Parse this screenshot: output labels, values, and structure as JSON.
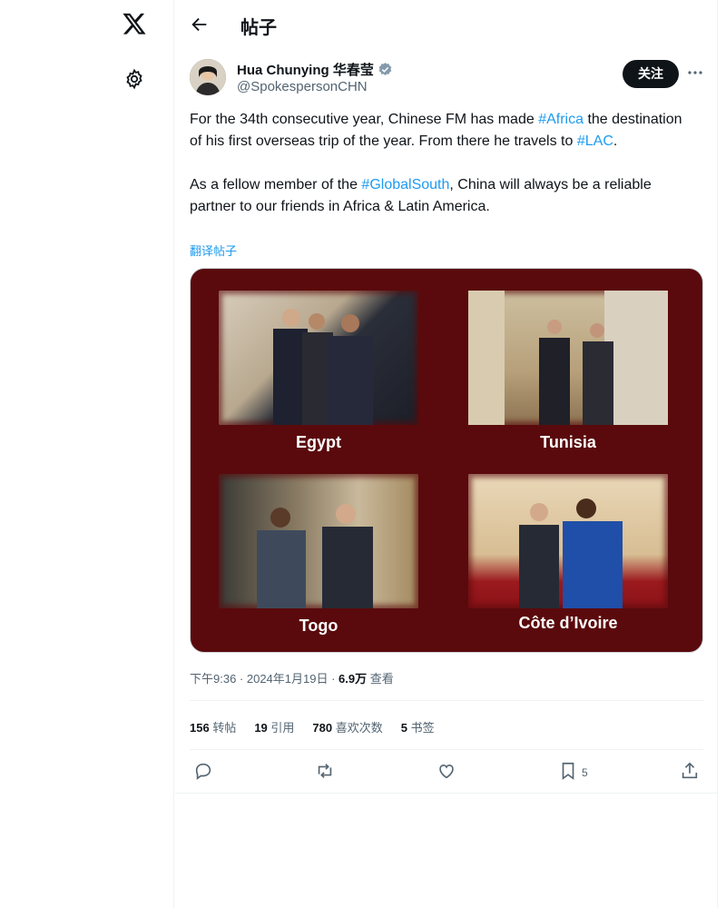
{
  "nav": {
    "logo_icon": "x-logo-icon",
    "settings_icon": "gear-icon"
  },
  "header": {
    "title": "帖子",
    "back_icon": "arrow-left-icon"
  },
  "author": {
    "name": "Hua Chunying 华春莹",
    "handle": "@SpokespersonCHN",
    "verified_icon": "verified-badge-icon",
    "follow_label": "关注"
  },
  "tweet": {
    "p1_a": "For the 34th consecutive year, Chinese FM has made ",
    "p1_tag1": "#Africa",
    "p1_b": " the destination of his first overseas trip of the year. From there he travels to ",
    "p1_tag2": "#LAC",
    "p1_c": ".",
    "p2_a": "As a fellow member of the ",
    "p2_tag": "#GlobalSouth",
    "p2_b": ", China will always be a reliable partner to our friends in Africa & Latin America.",
    "translate": "翻译帖子"
  },
  "media": {
    "background": "#5a0a0c",
    "captions": [
      "Egypt",
      "Tunisia",
      "Togo",
      "Côte d’Ivoire"
    ]
  },
  "meta": {
    "time": "下午9:36 · 2024年1月19日 · ",
    "views": "6.9万",
    "views_label": " 查看"
  },
  "stats": [
    {
      "count": "156",
      "label": " 转帖"
    },
    {
      "count": "19",
      "label": " 引用"
    },
    {
      "count": "780",
      "label": " 喜欢次数"
    },
    {
      "count": "5",
      "label": " 书签"
    }
  ],
  "actions": {
    "bookmark_count": "5"
  },
  "colors": {
    "accent": "#1d9bf0",
    "text": "#0f1419",
    "muted": "#536471"
  }
}
